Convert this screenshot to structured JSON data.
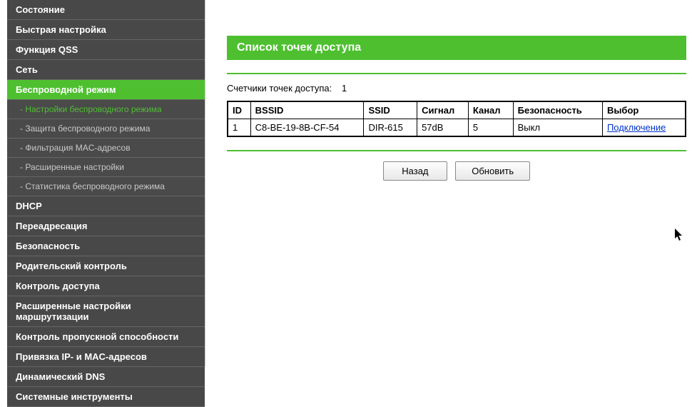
{
  "sidebar": {
    "items": [
      {
        "label": "Состояние",
        "type": "main"
      },
      {
        "label": "Быстрая настройка",
        "type": "main"
      },
      {
        "label": "Функция QSS",
        "type": "main"
      },
      {
        "label": "Сеть",
        "type": "main"
      },
      {
        "label": "Беспроводной режим",
        "type": "main",
        "active": true
      },
      {
        "label": "- Настройки беспроводного режима",
        "type": "sub",
        "active": true
      },
      {
        "label": "- Защита беспроводного режима",
        "type": "sub"
      },
      {
        "label": "- Фильтрация MAC-адресов",
        "type": "sub"
      },
      {
        "label": "- Расширенные настройки",
        "type": "sub"
      },
      {
        "label": "- Статистика беспроводного режима",
        "type": "sub"
      },
      {
        "label": "DHCP",
        "type": "main"
      },
      {
        "label": "Переадресация",
        "type": "main"
      },
      {
        "label": "Безопасность",
        "type": "main"
      },
      {
        "label": "Родительский контроль",
        "type": "main"
      },
      {
        "label": "Контроль доступа",
        "type": "main"
      },
      {
        "label": "Расширенные настройки маршрутизации",
        "type": "main"
      },
      {
        "label": "Контроль пропускной способности",
        "type": "main"
      },
      {
        "label": "Привязка IP- и MAC-адресов",
        "type": "main"
      },
      {
        "label": "Динамический DNS",
        "type": "main"
      },
      {
        "label": "Системные инструменты",
        "type": "main"
      }
    ]
  },
  "page": {
    "title": "Список точек доступа",
    "counter_label": "Счетчики точек доступа:",
    "counter_value": "1"
  },
  "table": {
    "headers": {
      "id": "ID",
      "bssid": "BSSID",
      "ssid": "SSID",
      "signal": "Сигнал",
      "channel": "Канал",
      "security": "Безопасность",
      "select": "Выбор"
    },
    "rows": [
      {
        "id": "1",
        "bssid": "C8-BE-19-8B-CF-54",
        "ssid": "DIR-615",
        "signal": "57dB",
        "channel": "5",
        "security": "Выкл",
        "select": "Подключение"
      }
    ]
  },
  "buttons": {
    "back": "Назад",
    "refresh": "Обновить"
  }
}
